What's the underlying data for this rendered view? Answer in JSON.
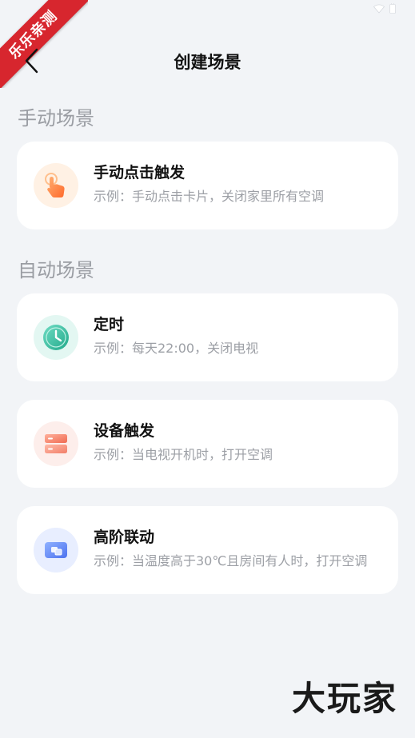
{
  "badge": "乐乐亲测",
  "header": {
    "title": "创建场景"
  },
  "sections": {
    "manual_title": "手动场景",
    "auto_title": "自动场景"
  },
  "cards": [
    {
      "title": "手动点击触发",
      "desc": "示例：手动点击卡片，关闭家里所有空调",
      "icon": "hand-tap-icon"
    },
    {
      "title": "定时",
      "desc": "示例：每天22:00，关闭电视",
      "icon": "clock-icon"
    },
    {
      "title": "设备触发",
      "desc": "示例：当电视开机时，打开空调",
      "icon": "device-icon"
    },
    {
      "title": "高阶联动",
      "desc": "示例：当温度高于30℃且房间有人时，打开空调",
      "icon": "linkage-icon"
    }
  ],
  "watermark": "大玩家",
  "colors": {
    "background": "#f2f4f7",
    "card": "#ffffff",
    "section_title": "#9a9da3",
    "desc": "#9c9fa5",
    "badge": "#d7262e"
  }
}
